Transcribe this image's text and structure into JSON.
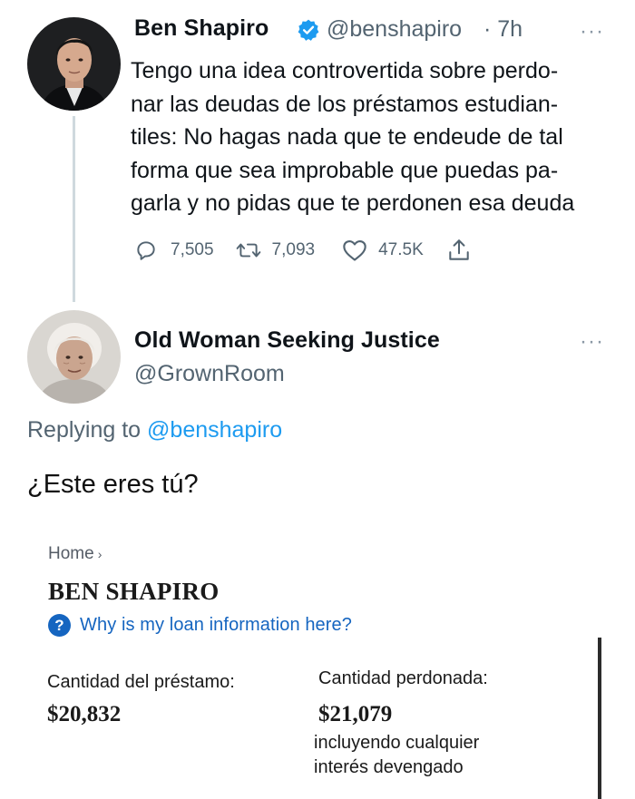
{
  "tweet": {
    "author_name": "Ben Shapiro",
    "handle": "@benshapiro",
    "time": "· 7h",
    "more": "···",
    "text_lines": [
      "Tengo una idea controvertida sobre perdo-",
      "nar las deudas de los préstamos estudian-",
      "tiles: No hagas nada que te endeude de tal",
      "forma que sea improbable que puedas pa-",
      "garla y no pidas que te perdonen esa deuda"
    ],
    "actions": {
      "replies": "7,505",
      "retweets": "7,093",
      "likes": "47.5K"
    }
  },
  "reply": {
    "author_name": "Old Woman Seeking Justice",
    "handle": "@GrownRoom",
    "more": "···",
    "replying_prefix": "Replying to ",
    "replying_handle": "@benshapiro",
    "text": "¿Este eres tú?"
  },
  "card": {
    "breadcrumb": "Home",
    "breadcrumb_chevron": "›",
    "title": "BEN SHAPIRO",
    "help_icon": "?",
    "help_text": "Why is my loan information here?",
    "loan_label": "Cantidad del préstamo:",
    "loan_amount": "$20,832",
    "forgiven_label": "Cantidad perdonada:",
    "forgiven_amount": "$21,079",
    "note_line1": "incluyendo cualquier",
    "note_line2": "interés devengado"
  },
  "colors": {
    "verified": "#1d9bf0",
    "link": "#1d9bf0",
    "muted": "#536471",
    "help_blue": "#1565c0"
  }
}
